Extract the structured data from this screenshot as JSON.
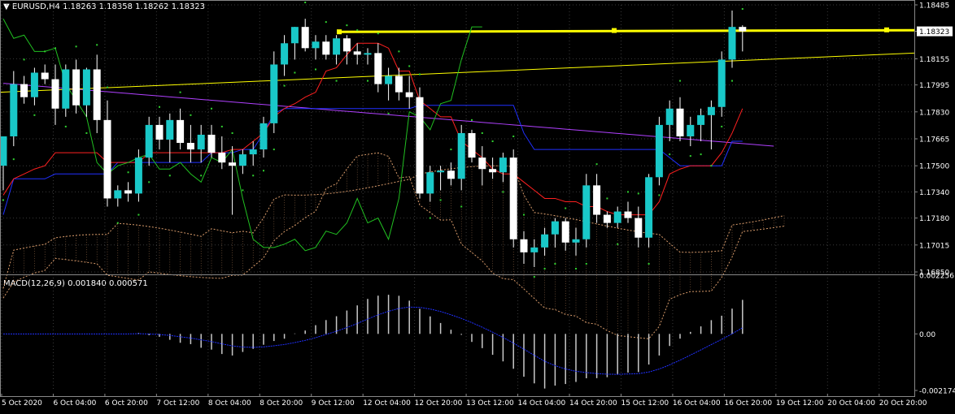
{
  "header": {
    "symbol": "EURUSD,H4",
    "ohlc": "1.18263 1.18358 1.18262 1.18323"
  },
  "macd": {
    "label": "MACD(12,26,9) 0.001840 0.000571"
  },
  "colors": {
    "background": "#000000",
    "grid": "#3a3a3a",
    "bull_candle": "#19c8c8",
    "bear_candle": "#ffffff",
    "tenkan": "#ff2020",
    "kijun": "#2030ff",
    "chikou": "#21c021",
    "senkou": "#d79a6a",
    "trendline": "#ffff00",
    "ma": "#b040ff",
    "macd_signal": "#2030ff",
    "price_marker": "#ffffff"
  },
  "chart_data": {
    "type": "candlestick",
    "price_axis": {
      "ylim": [
        1.1685,
        1.18485
      ],
      "ticks": [
        "1.18485",
        "1.18323",
        "1.18155",
        "1.17995",
        "1.17830",
        "1.17665",
        "1.17500",
        "1.17340",
        "1.17180",
        "1.17015",
        "1.16850"
      ],
      "current_price": "1.18323"
    },
    "time_axis": {
      "labels": [
        "5 Oct 2020",
        "6 Oct 04:00",
        "6 Oct 20:00",
        "7 Oct 12:00",
        "8 Oct 04:00",
        "8 Oct 20:00",
        "9 Oct 12:00",
        "12 Oct 04:00",
        "12 Oct 20:00",
        "13 Oct 12:00",
        "14 Oct 04:00",
        "14 Oct 20:00",
        "15 Oct 12:00",
        "16 Oct 04:00",
        "16 Oct 20:00",
        "19 Oct 12:00",
        "20 Oct 04:00",
        "20 Oct 20:00"
      ]
    },
    "macd_axis": {
      "ylim": [
        -0.002174,
        0.002256
      ],
      "ticks": [
        "0.002256",
        "0.00",
        "-0.002174"
      ]
    },
    "candles": [
      {
        "o": 1.175,
        "h": 1.1765,
        "l": 1.1735,
        "c": 1.1768
      },
      {
        "o": 1.1768,
        "h": 1.1808,
        "l": 1.1762,
        "c": 1.18
      },
      {
        "o": 1.18,
        "h": 1.1805,
        "l": 1.1788,
        "c": 1.1792
      },
      {
        "o": 1.1792,
        "h": 1.181,
        "l": 1.1787,
        "c": 1.1807
      },
      {
        "o": 1.1807,
        "h": 1.1812,
        "l": 1.18,
        "c": 1.1803
      },
      {
        "o": 1.1803,
        "h": 1.1812,
        "l": 1.1775,
        "c": 1.1785
      },
      {
        "o": 1.1785,
        "h": 1.1812,
        "l": 1.178,
        "c": 1.1809
      },
      {
        "o": 1.1809,
        "h": 1.1815,
        "l": 1.1782,
        "c": 1.1787
      },
      {
        "o": 1.1787,
        "h": 1.181,
        "l": 1.178,
        "c": 1.1809
      },
      {
        "o": 1.1809,
        "h": 1.1818,
        "l": 1.177,
        "c": 1.1778
      },
      {
        "o": 1.1778,
        "h": 1.179,
        "l": 1.1725,
        "c": 1.173
      },
      {
        "o": 1.173,
        "h": 1.1738,
        "l": 1.1725,
        "c": 1.1735
      },
      {
        "o": 1.1735,
        "h": 1.174,
        "l": 1.1728,
        "c": 1.1733
      },
      {
        "o": 1.1733,
        "h": 1.176,
        "l": 1.1728,
        "c": 1.1755
      },
      {
        "o": 1.1755,
        "h": 1.178,
        "l": 1.175,
        "c": 1.1775
      },
      {
        "o": 1.1775,
        "h": 1.178,
        "l": 1.176,
        "c": 1.1766
      },
      {
        "o": 1.1766,
        "h": 1.1782,
        "l": 1.1752,
        "c": 1.1778
      },
      {
        "o": 1.1778,
        "h": 1.1785,
        "l": 1.176,
        "c": 1.1764
      },
      {
        "o": 1.1764,
        "h": 1.1775,
        "l": 1.1752,
        "c": 1.176
      },
      {
        "o": 1.176,
        "h": 1.1775,
        "l": 1.1752,
        "c": 1.1769
      },
      {
        "o": 1.1769,
        "h": 1.1775,
        "l": 1.1755,
        "c": 1.1758
      },
      {
        "o": 1.1758,
        "h": 1.1768,
        "l": 1.1748,
        "c": 1.1752
      },
      {
        "o": 1.1752,
        "h": 1.1762,
        "l": 1.172,
        "c": 1.175
      },
      {
        "o": 1.175,
        "h": 1.176,
        "l": 1.1745,
        "c": 1.1757
      },
      {
        "o": 1.1757,
        "h": 1.1765,
        "l": 1.175,
        "c": 1.176
      },
      {
        "o": 1.176,
        "h": 1.178,
        "l": 1.1755,
        "c": 1.1776
      },
      {
        "o": 1.1776,
        "h": 1.182,
        "l": 1.177,
        "c": 1.1812
      },
      {
        "o": 1.1812,
        "h": 1.183,
        "l": 1.1805,
        "c": 1.1825
      },
      {
        "o": 1.1825,
        "h": 1.1835,
        "l": 1.1815,
        "c": 1.1835
      },
      {
        "o": 1.1835,
        "h": 1.184,
        "l": 1.182,
        "c": 1.1822
      },
      {
        "o": 1.1822,
        "h": 1.183,
        "l": 1.1815,
        "c": 1.1826
      },
      {
        "o": 1.1826,
        "h": 1.183,
        "l": 1.1815,
        "c": 1.1818
      },
      {
        "o": 1.1818,
        "h": 1.183,
        "l": 1.1812,
        "c": 1.1828
      },
      {
        "o": 1.1828,
        "h": 1.183,
        "l": 1.1812,
        "c": 1.182
      },
      {
        "o": 1.182,
        "h": 1.1825,
        "l": 1.1812,
        "c": 1.1818
      },
      {
        "o": 1.1818,
        "h": 1.1822,
        "l": 1.1812,
        "c": 1.1819
      },
      {
        "o": 1.1819,
        "h": 1.1825,
        "l": 1.1795,
        "c": 1.18
      },
      {
        "o": 1.18,
        "h": 1.181,
        "l": 1.179,
        "c": 1.1805
      },
      {
        "o": 1.1805,
        "h": 1.181,
        "l": 1.179,
        "c": 1.1795
      },
      {
        "o": 1.1795,
        "h": 1.1805,
        "l": 1.1785,
        "c": 1.1792
      },
      {
        "o": 1.1792,
        "h": 1.1798,
        "l": 1.173,
        "c": 1.1733
      },
      {
        "o": 1.1733,
        "h": 1.175,
        "l": 1.1728,
        "c": 1.1746
      },
      {
        "o": 1.1746,
        "h": 1.175,
        "l": 1.1735,
        "c": 1.1747
      },
      {
        "o": 1.1747,
        "h": 1.1752,
        "l": 1.1738,
        "c": 1.1742
      },
      {
        "o": 1.1742,
        "h": 1.1775,
        "l": 1.1735,
        "c": 1.177
      },
      {
        "o": 1.177,
        "h": 1.1772,
        "l": 1.1752,
        "c": 1.1755
      },
      {
        "o": 1.1755,
        "h": 1.1762,
        "l": 1.1738,
        "c": 1.1748
      },
      {
        "o": 1.1748,
        "h": 1.1755,
        "l": 1.1742,
        "c": 1.1746
      },
      {
        "o": 1.1746,
        "h": 1.1758,
        "l": 1.174,
        "c": 1.1755
      },
      {
        "o": 1.1755,
        "h": 1.176,
        "l": 1.17,
        "c": 1.1705
      },
      {
        "o": 1.1705,
        "h": 1.171,
        "l": 1.169,
        "c": 1.1697
      },
      {
        "o": 1.1697,
        "h": 1.1705,
        "l": 1.1688,
        "c": 1.17
      },
      {
        "o": 1.17,
        "h": 1.1712,
        "l": 1.1695,
        "c": 1.1708
      },
      {
        "o": 1.1708,
        "h": 1.1718,
        "l": 1.17,
        "c": 1.1716
      },
      {
        "o": 1.1716,
        "h": 1.1718,
        "l": 1.1698,
        "c": 1.1703
      },
      {
        "o": 1.1703,
        "h": 1.1712,
        "l": 1.1695,
        "c": 1.1705
      },
      {
        "o": 1.1705,
        "h": 1.1745,
        "l": 1.17,
        "c": 1.1738
      },
      {
        "o": 1.1738,
        "h": 1.1745,
        "l": 1.1715,
        "c": 1.172
      },
      {
        "o": 1.172,
        "h": 1.1722,
        "l": 1.1712,
        "c": 1.1715
      },
      {
        "o": 1.1715,
        "h": 1.1725,
        "l": 1.1712,
        "c": 1.1722
      },
      {
        "o": 1.1722,
        "h": 1.1728,
        "l": 1.1715,
        "c": 1.1718
      },
      {
        "o": 1.1718,
        "h": 1.1725,
        "l": 1.17,
        "c": 1.1706
      },
      {
        "o": 1.1706,
        "h": 1.1745,
        "l": 1.17,
        "c": 1.1743
      },
      {
        "o": 1.1743,
        "h": 1.178,
        "l": 1.1738,
        "c": 1.1775
      },
      {
        "o": 1.1775,
        "h": 1.179,
        "l": 1.1765,
        "c": 1.1785
      },
      {
        "o": 1.1785,
        "h": 1.1792,
        "l": 1.1765,
        "c": 1.1768
      },
      {
        "o": 1.1768,
        "h": 1.178,
        "l": 1.1762,
        "c": 1.1775
      },
      {
        "o": 1.1775,
        "h": 1.1785,
        "l": 1.1765,
        "c": 1.1781
      },
      {
        "o": 1.1781,
        "h": 1.179,
        "l": 1.176,
        "c": 1.1786
      },
      {
        "o": 1.1786,
        "h": 1.182,
        "l": 1.178,
        "c": 1.1815
      },
      {
        "o": 1.1815,
        "h": 1.1845,
        "l": 1.181,
        "c": 1.1835
      },
      {
        "o": 1.1835,
        "h": 1.1836,
        "l": 1.182,
        "c": 1.18323
      }
    ],
    "tenkan": [
      1.1732,
      1.1742,
      1.1745,
      1.1748,
      1.175,
      1.1758,
      1.1758,
      1.1758,
      1.1758,
      1.1758,
      1.1752,
      1.1752,
      1.1752,
      1.1752,
      1.1758,
      1.1758,
      1.1758,
      1.1758,
      1.1758,
      1.1758,
      1.1758,
      1.1758,
      1.176,
      1.176,
      1.1765,
      1.177,
      1.178,
      1.1785,
      1.1788,
      1.1792,
      1.1795,
      1.1808,
      1.181,
      1.1818,
      1.1825,
      1.1825,
      1.1825,
      1.1822,
      1.1808,
      1.1808,
      1.179,
      1.1785,
      1.178,
      1.178,
      1.1765,
      1.176,
      1.1755,
      1.1748,
      1.1745,
      1.1745,
      1.174,
      1.1735,
      1.173,
      1.173,
      1.1728,
      1.1728,
      1.1725,
      1.1725,
      1.1722,
      1.172,
      1.172,
      1.172,
      1.172,
      1.1728,
      1.1745,
      1.1748,
      1.175,
      1.175,
      1.175,
      1.1758,
      1.177,
      1.1785
    ],
    "kijun": [
      1.172,
      1.1742,
      1.1742,
      1.1742,
      1.1742,
      1.1745,
      1.1745,
      1.1745,
      1.1745,
      1.1745,
      1.1745,
      1.1752,
      1.1752,
      1.1752,
      1.1752,
      1.1752,
      1.1752,
      1.1752,
      1.1752,
      1.1752,
      1.1758,
      1.1758,
      1.1758,
      1.176,
      1.176,
      1.177,
      1.1782,
      1.1785,
      1.1785,
      1.1785,
      1.1785,
      1.1785,
      1.1785,
      1.1785,
      1.1785,
      1.1785,
      1.1785,
      1.1785,
      1.1785,
      1.1785,
      1.1787,
      1.1787,
      1.1787,
      1.1787,
      1.1787,
      1.1787,
      1.1787,
      1.1787,
      1.1787,
      1.1787,
      1.177,
      1.176,
      1.176,
      1.176,
      1.176,
      1.176,
      1.176,
      1.176,
      1.176,
      1.176,
      1.176,
      1.176,
      1.176,
      1.176,
      1.1755,
      1.175,
      1.175,
      1.175,
      1.175,
      1.175,
      1.1765,
      1.1765
    ],
    "chikou": [
      1.184,
      1.1828,
      1.183,
      1.182,
      1.182,
      1.1822,
      1.18,
      1.179,
      1.178,
      1.1752,
      1.1745,
      1.175,
      1.1752,
      1.1755,
      1.1757,
      1.1748,
      1.1748,
      1.1752,
      1.1745,
      1.174,
      1.1755,
      1.1752,
      1.176,
      1.173,
      1.1705,
      1.17,
      1.17,
      1.1702,
      1.1705,
      1.1698,
      1.17,
      1.171,
      1.1708,
      1.1715,
      1.173,
      1.1715,
      1.1718,
      1.1705,
      1.173,
      1.1783,
      1.178,
      1.1772,
      1.1788,
      1.179,
      1.1815,
      1.1835,
      1.1835
    ]
  }
}
